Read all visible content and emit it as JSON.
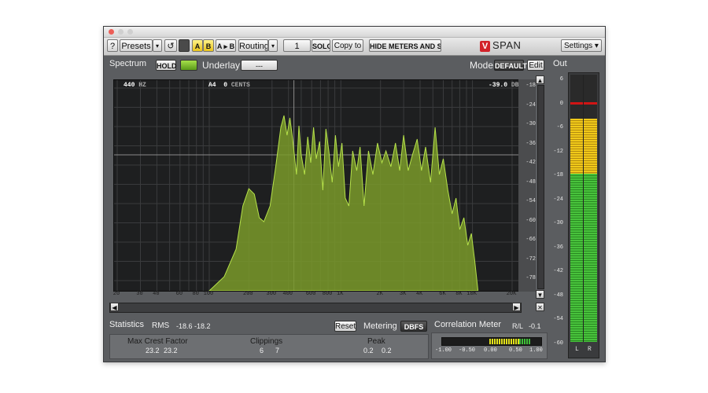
{
  "app": {
    "name": "SPAN",
    "logo_letter": "V"
  },
  "toolbar": {
    "help": "?",
    "presets": "Presets",
    "reset_icon": "↺",
    "a": "A",
    "b": "B",
    "ab": "A ▸ B",
    "routing": "Routing",
    "channel": "1",
    "solo": "SOLO",
    "copy_to": "Copy to",
    "hide": "HIDE METERS AND STATS",
    "settings": "Settings"
  },
  "spectrum": {
    "label": "Spectrum",
    "hold": "HOLD",
    "underlay_label": "Underlay",
    "underlay_value": "---",
    "mode_label": "Mode",
    "mode_value": "DEFAULT",
    "edit": "Edit",
    "readout_freq": "440",
    "readout_freq_unit": "HZ",
    "readout_note": "A4",
    "readout_cents": "0",
    "readout_cents_unit": "CENTS",
    "readout_db": "-39.0",
    "readout_db_unit": "DB",
    "db_ticks": [
      "-18",
      "-24",
      "-30",
      "-36",
      "-42",
      "-48",
      "-54",
      "-60",
      "-66",
      "-72",
      "-78"
    ],
    "freq_ticks": [
      "20",
      "30",
      "40",
      "60",
      "80",
      "100",
      "200",
      "300",
      "400",
      "600",
      "800",
      "1K",
      "2K",
      "3K",
      "4K",
      "6K",
      "8K",
      "10K",
      "20K"
    ]
  },
  "out": {
    "label": "Out",
    "ticks": [
      "6",
      "0",
      "-6",
      "-12",
      "-18",
      "-24",
      "-30",
      "-36",
      "-42",
      "-48",
      "-54",
      "-60"
    ],
    "channels": [
      "L",
      "R"
    ]
  },
  "statistics": {
    "label": "Statistics",
    "rms_label": "RMS",
    "rms_l": "-18.6",
    "rms_r": "-18.2",
    "reset": "Reset",
    "metering_label": "Metering",
    "metering_value": "DBFS",
    "crest_label": "Max Crest Factor",
    "crest_l": "23.2",
    "crest_r": "23.2",
    "clip_label": "Clippings",
    "clip_l": "6",
    "clip_r": "7",
    "peak_label": "Peak",
    "peak_l": "0.2",
    "peak_r": "0.2"
  },
  "correlation": {
    "label": "Correlation Meter",
    "lr_label": "R/L",
    "value": "-0.1",
    "ticks": [
      "-1.00",
      "-0.50",
      "0.00",
      "0.50",
      "1.00"
    ]
  },
  "colors": {
    "spectrum_fill": "#7a9a2a",
    "spectrum_edge": "#b6e24a",
    "meter_green": "#3fb83a",
    "meter_yellow": "#e3c21f",
    "peak_line": "#d01515"
  }
}
